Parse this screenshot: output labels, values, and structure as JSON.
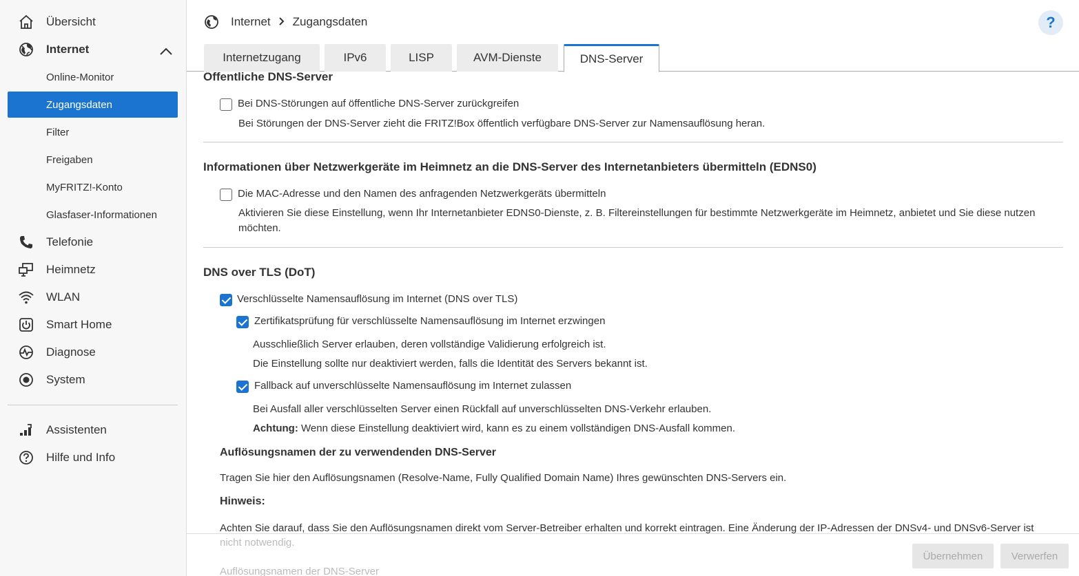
{
  "sidebar": {
    "items": [
      {
        "label": "Übersicht",
        "icon": "home-icon"
      },
      {
        "label": "Internet",
        "icon": "globe-icon"
      },
      {
        "label": "Telefonie",
        "icon": "phone-icon"
      },
      {
        "label": "Heimnetz",
        "icon": "network-icon"
      },
      {
        "label": "WLAN",
        "icon": "wifi-icon"
      },
      {
        "label": "Smart Home",
        "icon": "smart-home-icon"
      },
      {
        "label": "Diagnose",
        "icon": "diagnose-icon"
      },
      {
        "label": "System",
        "icon": "system-icon"
      },
      {
        "label": "Assistenten",
        "icon": "assistant-icon"
      },
      {
        "label": "Hilfe und Info",
        "icon": "help-circle-icon"
      }
    ],
    "internet_sub": [
      "Online-Monitor",
      "Zugangsdaten",
      "Filter",
      "Freigaben",
      "MyFRITZ!-Konto",
      "Glasfaser-Informationen"
    ],
    "active_sub": "Zugangsdaten"
  },
  "header": {
    "breadcrumb": [
      "Internet",
      "Zugangsdaten"
    ],
    "help_label": "?"
  },
  "tabs": [
    "Internetzugang",
    "IPv6",
    "LISP",
    "AVM-Dienste",
    "DNS-Server"
  ],
  "active_tab": "DNS-Server",
  "content": {
    "public_dns_title": "Öffentliche DNS-Server",
    "public_dns_checkbox": "Bei DNS-Störungen auf öffentliche DNS-Server zurückgreifen",
    "public_dns_desc": "Bei Störungen der DNS-Server zieht die FRITZ!Box öffentlich verfügbare DNS-Server zur Namensauflösung heran.",
    "edns_title": "Informationen über Netzwerkgeräte im Heimnetz an die DNS-Server des Internetanbieters übermitteln (EDNS0)",
    "edns_checkbox": "Die MAC-Adresse und den Namen des anfragenden Netzwerkgeräts übermitteln",
    "edns_desc_1": "Aktivieren Sie diese Einstellung, wenn Ihr Internetanbieter EDNS0-Dienste, z. B. Filtereinstellungen für bestimmte Netzwerkgeräte im Heimnetz, anbietet und Sie diese nutzen",
    "edns_desc_2": "möchten.",
    "dot_title": "DNS over TLS (DoT)",
    "dot_checkbox": "Verschlüsselte Namensauflösung im Internet (DNS over TLS)",
    "cert_checkbox": "Zertifikatsprüfung für verschlüsselte Namensauflösung im Internet erzwingen",
    "cert_desc_1": "Ausschließlich Server erlauben, deren vollständige Validierung erfolgreich ist.",
    "cert_desc_2": "Die Einstellung sollte nur deaktiviert werden, falls die Identität des Servers bekannt ist.",
    "fallback_checkbox": "Fallback auf unverschlüsselte Namensauflösung im Internet zulassen",
    "fallback_desc": "Bei Ausfall aller verschlüsselten Server einen Rückfall auf unverschlüsselten DNS-Verkehr erlauben.",
    "warning_label": "Achtung:",
    "warning_text": " Wenn diese Einstellung deaktiviert wird, kann es zu einem vollständigen DNS-Ausfall kommen.",
    "resolve_title": "Auflösungsnamen der zu verwendenden DNS-Server",
    "resolve_desc": "Tragen Sie hier den Auflösungsnamen (Resolve-Name, Fully Qualified Domain Name) Ihres gewünschten DNS-Servers ein.",
    "hint_title": "Hinweis:",
    "hint_text_1": "Achten Sie darauf, dass Sie den Auflösungsnamen direkt vom Server-Betreiber erhalten und korrekt eintragen. Eine Änderung der IP-Adressen der DNSv4- und DNSv6-Server ist",
    "hint_text_2": "nicht notwendig.",
    "faded_label": "Auflösungsnamen der DNS-Server"
  },
  "checkbox_state": {
    "public_dns": false,
    "edns": false,
    "dot": true,
    "cert": true,
    "fallback": true
  },
  "footer": {
    "apply_label": "Übernehmen",
    "discard_label": "Verwerfen"
  },
  "colors": {
    "accent": "#1b75d0"
  }
}
